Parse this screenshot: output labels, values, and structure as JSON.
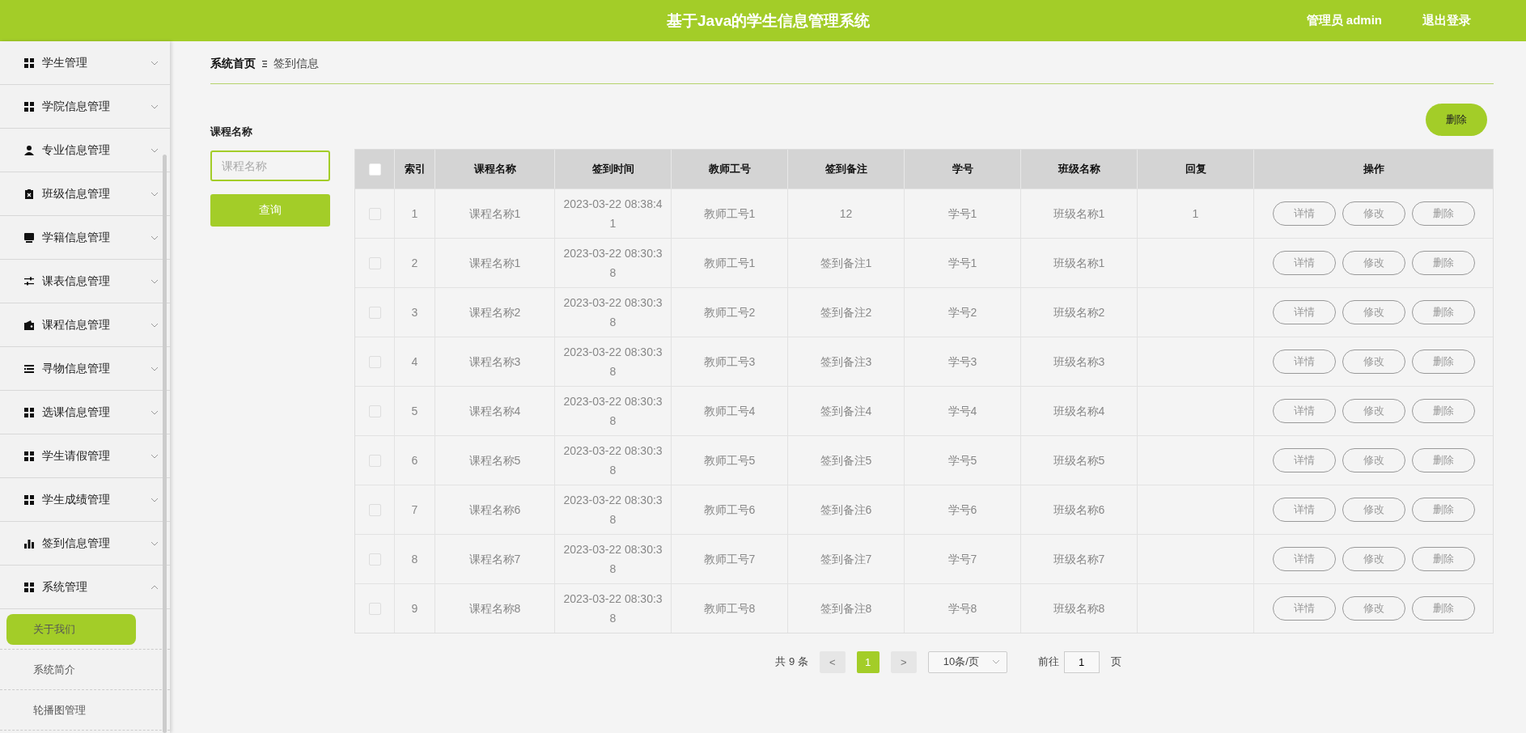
{
  "header": {
    "title": "基于Java的学生信息管理系统",
    "user": "管理员 admin",
    "logout": "退出登录"
  },
  "sidebar": {
    "items": [
      {
        "label": "学生管理",
        "expanded": false
      },
      {
        "label": "学院信息管理",
        "expanded": false
      },
      {
        "label": "专业信息管理",
        "expanded": false
      },
      {
        "label": "班级信息管理",
        "expanded": false
      },
      {
        "label": "学籍信息管理",
        "expanded": false
      },
      {
        "label": "课表信息管理",
        "expanded": false
      },
      {
        "label": "课程信息管理",
        "expanded": false
      },
      {
        "label": "寻物信息管理",
        "expanded": false
      },
      {
        "label": "选课信息管理",
        "expanded": false
      },
      {
        "label": "学生请假管理",
        "expanded": false
      },
      {
        "label": "学生成绩管理",
        "expanded": false
      },
      {
        "label": "签到信息管理",
        "expanded": false
      },
      {
        "label": "系统管理",
        "expanded": true,
        "children": [
          {
            "label": "关于我们",
            "selected": true
          },
          {
            "label": "系统简介",
            "selected": false
          },
          {
            "label": "轮播图管理",
            "selected": false
          }
        ]
      }
    ]
  },
  "breadcrumb": [
    "系统首页",
    "签到信息"
  ],
  "search": {
    "label": "课程名称",
    "placeholder": "课程名称",
    "button": "查询"
  },
  "delete_button": "删除",
  "table": {
    "select_all": {
      "checked": false
    },
    "columns": [
      "索引",
      "课程名称",
      "签到时间",
      "教师工号",
      "签到备注",
      "学号",
      "班级名称",
      "回复",
      "操作"
    ],
    "rows": [
      {
        "checked": false,
        "cells": [
          "1",
          "课程名称1",
          "2023-03-22 08:38:41",
          "教师工号1",
          "12",
          "学号1",
          "班级名称1",
          "1"
        ],
        "actions": [
          "详情",
          "修改",
          "删除"
        ]
      },
      {
        "checked": false,
        "cells": [
          "2",
          "课程名称1",
          "2023-03-22 08:30:38",
          "教师工号1",
          "签到备注1",
          "学号1",
          "班级名称1"
        ],
        "actions": [
          "详情",
          "修改",
          "删除"
        ]
      },
      {
        "checked": false,
        "cells": [
          "3",
          "课程名称2",
          "2023-03-22 08:30:38",
          "教师工号2",
          "签到备注2",
          "学号2",
          "班级名称2"
        ],
        "actions": [
          "详情",
          "修改",
          "删除"
        ]
      },
      {
        "checked": false,
        "cells": [
          "4",
          "课程名称3",
          "2023-03-22 08:30:38",
          "教师工号3",
          "签到备注3",
          "学号3",
          "班级名称3"
        ],
        "actions": [
          "详情",
          "修改",
          "删除"
        ]
      },
      {
        "checked": false,
        "cells": [
          "5",
          "课程名称4",
          "2023-03-22 08:30:38",
          "教师工号4",
          "签到备注4",
          "学号4",
          "班级名称4"
        ],
        "actions": [
          "详情",
          "修改",
          "删除"
        ]
      },
      {
        "checked": false,
        "cells": [
          "6",
          "课程名称5",
          "2023-03-22 08:30:38",
          "教师工号5",
          "签到备注5",
          "学号5",
          "班级名称5"
        ],
        "actions": [
          "详情",
          "修改",
          "删除"
        ]
      },
      {
        "checked": false,
        "cells": [
          "7",
          "课程名称6",
          "2023-03-22 08:30:38",
          "教师工号6",
          "签到备注6",
          "学号6",
          "班级名称6"
        ],
        "actions": [
          "详情",
          "修改",
          "删除"
        ]
      },
      {
        "checked": false,
        "cells": [
          "8",
          "课程名称7",
          "2023-03-22 08:30:38",
          "教师工号7",
          "签到备注7",
          "学号7",
          "班级名称7"
        ],
        "actions": [
          "详情",
          "修改",
          "删除"
        ]
      },
      {
        "checked": false,
        "cells": [
          "9",
          "课程名称8",
          "2023-03-22 08:30:38",
          "教师工号8",
          "签到备注8",
          "学号8",
          "班级名称8"
        ],
        "actions": [
          "详情",
          "修改",
          "删除"
        ]
      }
    ]
  },
  "pagination": {
    "total": "共 9 条",
    "prev": "<",
    "pages": [
      {
        "label": "1",
        "selected": true
      }
    ],
    "next": ">",
    "page_size": "10条/页",
    "goto": "前往",
    "goto_value": "1",
    "page_unit": "页"
  }
}
